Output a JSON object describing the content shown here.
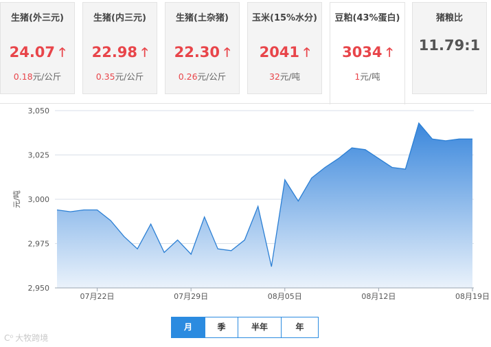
{
  "cards": [
    {
      "title": "生猪(外三元)",
      "value": "24.07",
      "trend": "up",
      "change": "0.18",
      "unit": "元/公斤"
    },
    {
      "title": "生猪(内三元)",
      "value": "22.98",
      "trend": "up",
      "change": "0.35",
      "unit": "元/公斤"
    },
    {
      "title": "生猪(土杂猪)",
      "value": "22.30",
      "trend": "up",
      "change": "0.26",
      "unit": "元/公斤"
    },
    {
      "title": "玉米(15%水分)",
      "value": "2041",
      "trend": "up",
      "change": "32",
      "unit": "元/吨"
    },
    {
      "title": "豆粕(43%蛋白)",
      "value": "3034",
      "trend": "up",
      "change": "1",
      "unit": "元/吨"
    },
    {
      "title": "猪粮比",
      "value": "11.79:1"
    }
  ],
  "arrow_symbol": "🡑",
  "chart_data": {
    "type": "area",
    "ylabel": "元/吨",
    "ylim": [
      2950,
      3050
    ],
    "yticks": [
      "2,950",
      "2,975",
      "3,000",
      "3,025",
      "3,050"
    ],
    "xticks": [
      "07月22日",
      "07月29日",
      "08月05日",
      "08月12日",
      "08月19日"
    ],
    "x": [
      "07-19",
      "07-20",
      "07-21",
      "07-22",
      "07-23",
      "07-24",
      "07-25",
      "07-26",
      "07-27",
      "07-28",
      "07-29",
      "07-30",
      "07-31",
      "08-01",
      "08-02",
      "08-03",
      "08-04",
      "08-05",
      "08-06",
      "08-07",
      "08-08",
      "08-09",
      "08-10",
      "08-11",
      "08-12",
      "08-13",
      "08-14",
      "08-15",
      "08-16",
      "08-17",
      "08-18",
      "08-19"
    ],
    "values": [
      2994,
      2993,
      2994,
      2994,
      2988,
      2979,
      2972,
      2986,
      2970,
      2977,
      2969,
      2990,
      2972,
      2971,
      2977,
      2996,
      2962,
      3011,
      2999,
      3012,
      3018,
      3023,
      3029,
      3028,
      3023,
      3018,
      3017,
      3043,
      3034,
      3033,
      3034,
      3034
    ],
    "grid": true,
    "colors": {
      "line": "#2b7fd4",
      "fill_top": "#3a87dc",
      "fill_bottom": "#eaf2fb"
    }
  },
  "tabs": [
    {
      "label": "月",
      "active": true
    },
    {
      "label": "季",
      "active": false
    },
    {
      "label": "半年",
      "active": false
    },
    {
      "label": "年",
      "active": false
    }
  ],
  "watermark": "大牧跨境"
}
